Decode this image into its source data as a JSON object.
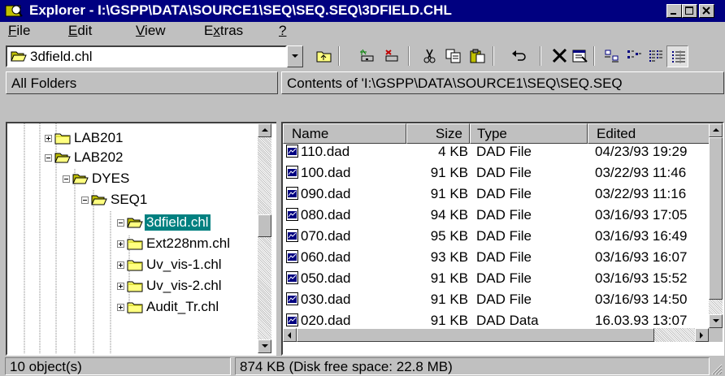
{
  "window": {
    "title": "Explorer - I:\\GSPP\\DATA\\SOURCE1\\SEQ\\SEQ.SEQ\\3DFIELD.CHL"
  },
  "menu": [
    {
      "label": "File",
      "underline": "F"
    },
    {
      "label": "Edit",
      "underline": "E"
    },
    {
      "label": "View",
      "underline": "V"
    },
    {
      "label": "Extras",
      "underline": "x"
    },
    {
      "label": "?",
      "underline": "?"
    }
  ],
  "toolbar": {
    "address_value": "3dfield.chl",
    "buttons": [
      "up-folder-icon",
      "map-drive-icon",
      "disconnect-drive-icon",
      "cut-icon",
      "copy-icon",
      "paste-icon",
      "undo-icon",
      "delete-icon",
      "properties-icon",
      "large-icons-icon",
      "small-icons-icon",
      "list-icon",
      "details-icon"
    ]
  },
  "left_panel": {
    "header": "All Folders"
  },
  "right_panel": {
    "header": "Contents of 'I:\\GSPP\\DATA\\SOURCE1\\SEQ\\SEQ.SEQ"
  },
  "tree": [
    {
      "label": "LAB201",
      "expander": "plus",
      "open": false,
      "selected": false
    },
    {
      "label": "LAB202",
      "expander": "minus",
      "open": true,
      "selected": false
    },
    {
      "label": "DYES",
      "expander": "minus",
      "open": true,
      "selected": false
    },
    {
      "label": "SEQ1",
      "expander": "minus",
      "open": true,
      "selected": false
    },
    {
      "label": "3dfield.chl",
      "expander": "minus",
      "open": true,
      "selected": true
    },
    {
      "label": "Ext228nm.chl",
      "expander": "plus",
      "open": false,
      "selected": false
    },
    {
      "label": "Uv_vis-1.chl",
      "expander": "plus",
      "open": false,
      "selected": false
    },
    {
      "label": "Uv_vis-2.chl",
      "expander": "plus",
      "open": false,
      "selected": false
    },
    {
      "label": "Audit_Tr.chl",
      "expander": "plus",
      "open": false,
      "selected": false
    }
  ],
  "columns": [
    "Name",
    "Size",
    "Type",
    "Edited"
  ],
  "files": [
    {
      "name": "110.dad",
      "size": "4 KB",
      "type": "DAD File",
      "edited": "04/23/93 19:29"
    },
    {
      "name": "100.dad",
      "size": "91 KB",
      "type": "DAD File",
      "edited": "03/22/93 11:46"
    },
    {
      "name": "090.dad",
      "size": "91 KB",
      "type": "DAD File",
      "edited": "03/22/93 11:16"
    },
    {
      "name": "080.dad",
      "size": "94 KB",
      "type": "DAD File",
      "edited": "03/16/93 17:05"
    },
    {
      "name": "070.dad",
      "size": "95 KB",
      "type": "DAD File",
      "edited": "03/16/93 16:49"
    },
    {
      "name": "060.dad",
      "size": "93 KB",
      "type": "DAD File",
      "edited": "03/16/93 16:07"
    },
    {
      "name": "050.dad",
      "size": "91 KB",
      "type": "DAD File",
      "edited": "03/16/93 15:52"
    },
    {
      "name": "030.dad",
      "size": "91 KB",
      "type": "DAD File",
      "edited": "03/16/93 14:50"
    },
    {
      "name": "020.dad",
      "size": "91 KB",
      "type": "DAD Data",
      "edited": "16.03.93 13:07"
    }
  ],
  "status": {
    "objects": "10 object(s)",
    "space": "874 KB (Disk free space: 22.8 MB)"
  },
  "colors": {
    "titlebar": "#000080",
    "face": "#c0c0c0",
    "selection": "#008080"
  }
}
